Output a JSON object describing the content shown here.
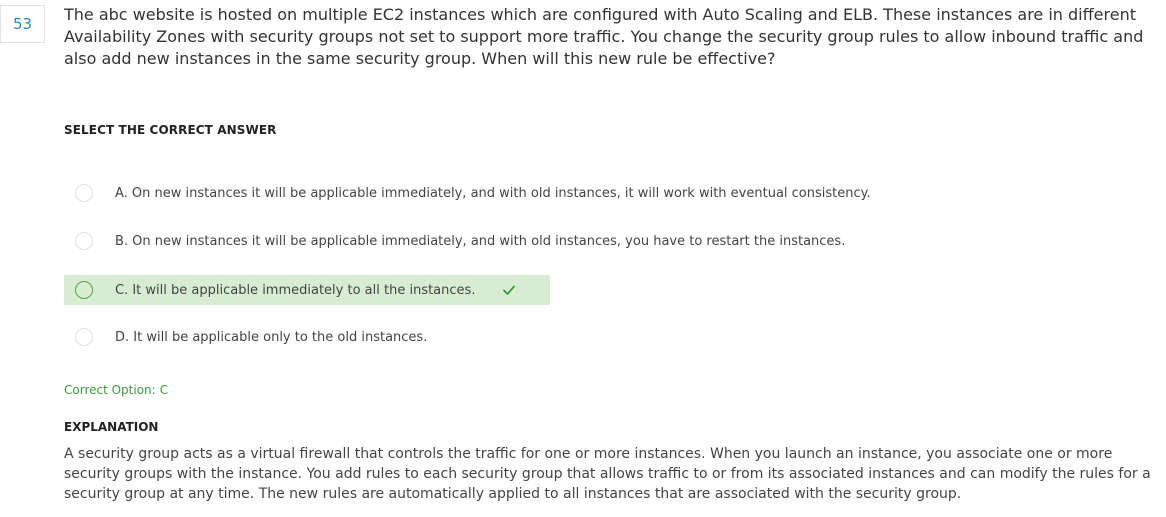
{
  "question": {
    "number": "53",
    "text": "The abc website is hosted on multiple EC2 instances which are configured with Auto Scaling and ELB. These instances are in different Availability Zones with security groups not set to support more traffic. You change the security group rules to allow inbound traffic and also add new instances in the same security group. When will this new rule be effective?"
  },
  "select_heading": "SELECT THE CORRECT ANSWER",
  "options": [
    {
      "label": "A. On new instances it will be applicable immediately, and with old instances, it will work with eventual consistency.",
      "is_correct": false
    },
    {
      "label": "B. On new instances it will be applicable immediately, and with old instances, you have to restart the instances.",
      "is_correct": false
    },
    {
      "label": "C. It will be applicable immediately to all the instances.",
      "is_correct": true,
      "icon": "checkmark-icon"
    },
    {
      "label": "D. It will be applicable only to the old instances.",
      "is_correct": false
    }
  ],
  "result": {
    "label": "Correct Option:",
    "value": "C"
  },
  "explanation": {
    "heading": "EXPLANATION",
    "text": "A security group acts as a virtual firewall that controls the traffic for one or more instances. When you launch an instance, you associate one or more security groups with the instance. You add rules to each security group that allows traffic to or from its associated instances and can modify the rules for a security group at any time. The new rules are automatically applied to all instances that are associated with the security group."
  },
  "colors": {
    "accent_blue": "#2a87c8",
    "correct_green": "#3c9c3c",
    "correct_bg": "#d8ecd4"
  }
}
